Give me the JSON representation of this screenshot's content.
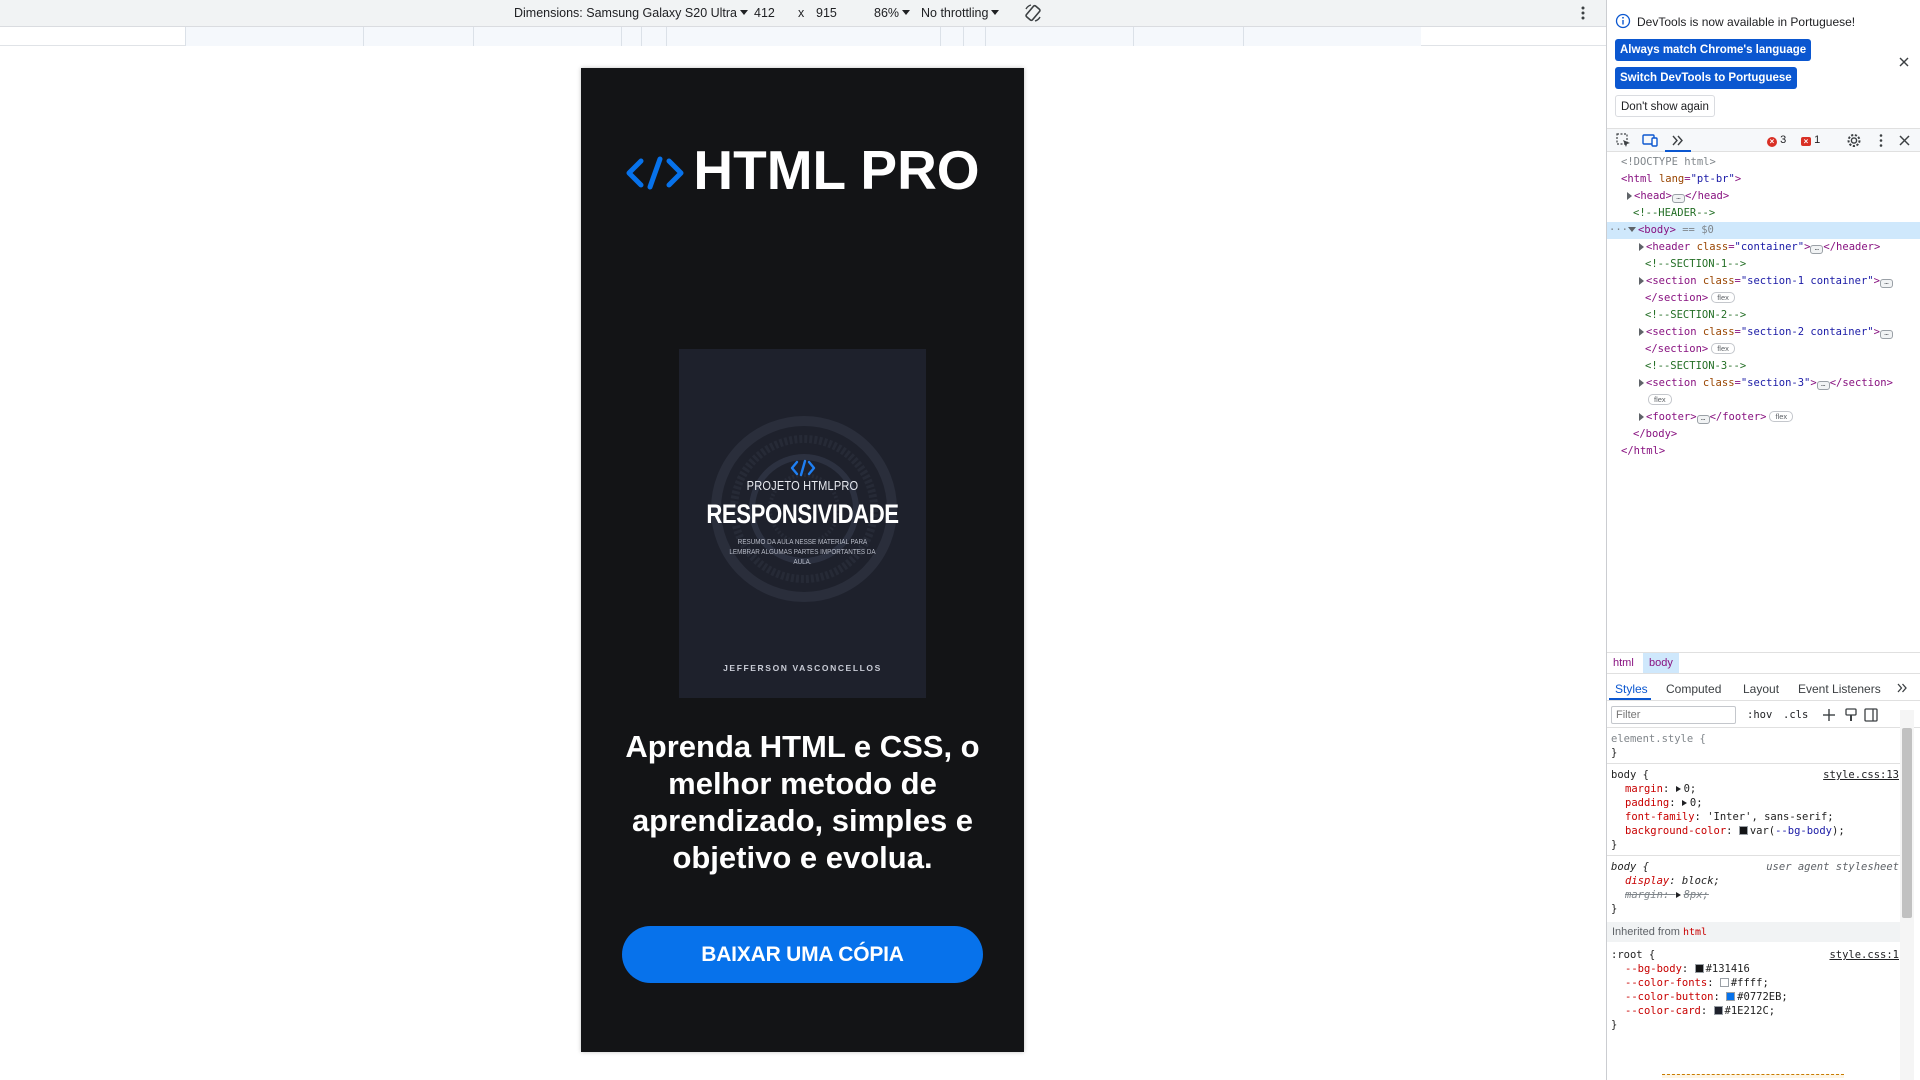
{
  "device_toolbar": {
    "dimensions_label": "Dimensions: Samsung Galaxy S20 Ultra",
    "width_value": "412",
    "times_symbol": "x",
    "height_value": "915",
    "zoom_label": "86%",
    "throttling_label": "No throttling"
  },
  "page": {
    "logo_text": "HTML PRO",
    "cover": {
      "project_label": "PROJETO HTMLPRO",
      "title": "RESPONSIVIDADE",
      "description": "RESUMO DA AULA NESSE MATERIAL PARA LEMBRAR ALGUMAS PARTES IMPORTANTES DA AULA.",
      "author": "JEFFERSON VASCONCELLOS"
    },
    "headline": "Aprenda HTML e CSS, o melhor metodo de aprendizado, simples e objetivo e evolua.",
    "download_button": "BAIXAR UMA CÓPIA"
  },
  "devtools": {
    "notice": {
      "text": "DevTools is now available in Portuguese!",
      "match_button": "Always match Chrome's language",
      "switch_button": "Switch DevTools to Portuguese",
      "dont_show_button": "Don't show again"
    },
    "error_count": "3",
    "warning_count": "1",
    "elements": {
      "doctype": "<!DOCTYPE html>",
      "html_open_tag": "<html",
      "lang_attr": "lang",
      "lang_val": "\"pt-br\"",
      "head_open": "<head>",
      "head_close": "</head>",
      "comment_header": "<!--HEADER-->",
      "body_open": "<body>",
      "body_eq": "== $0",
      "header_open": "<header",
      "class_attr": "class",
      "header_class": "\"container\"",
      "header_close": "</header>",
      "comment_s1": "<!--SECTION-1-->",
      "section_open": "<section",
      "s1_class": "\"section-1 container\"",
      "section_close": "</section>",
      "comment_s2": "<!--SECTION-2-->",
      "s2_class": "\"section-2 container\"",
      "comment_s3": "<!--SECTION-3-->",
      "s3_class": "\"section-3\"",
      "footer_open": "<footer>",
      "footer_close": "</footer>",
      "body_close": "</body>",
      "html_close": "</html>",
      "flex_badge": "flex"
    },
    "breadcrumb": [
      "html",
      "body"
    ],
    "styles_tabs": [
      "Styles",
      "Computed",
      "Layout",
      "Event Listeners"
    ],
    "filter_placeholder": "Filter",
    "hov_label": ":hov",
    "cls_label": ".cls",
    "styles": {
      "element_style": "element.style {",
      "close_brace": "}",
      "body_selector": "body {",
      "body_source": "style.css:13",
      "margin_prop": "margin",
      "margin_val": "0;",
      "padding_prop": "padding",
      "padding_val": "0;",
      "font_family_prop": "font-family",
      "font_family_val": "'Inter', sans-serif;",
      "bg_color_prop": "background-color",
      "bg_color_var_fn": "var(",
      "bg_color_var_name": "--bg-body",
      "bg_color_var_end": ");",
      "ua_selector": "body {",
      "ua_source": "user agent stylesheet",
      "display_prop": "display",
      "display_val": "block;",
      "ua_margin_prop": "margin",
      "ua_margin_val": "8px;",
      "inherited_from": "Inherited from",
      "inherited_tag": "html",
      "root_selector": ":root {",
      "root_source": "style.css:1",
      "vars": [
        {
          "name": "--bg-body",
          "value": "#131416",
          "color": "#131416"
        },
        {
          "name": "--color-fonts",
          "value": "#ffff;",
          "color": "#ffffff"
        },
        {
          "name": "--color-button",
          "value": "#0772EB;",
          "color": "#0772EB"
        },
        {
          "name": "--color-card",
          "value": "#1E212C;",
          "color": "#1E212C"
        }
      ]
    }
  },
  "colors": {
    "page_bg": "#131416",
    "button": "#0772EB",
    "card": "#1E212C",
    "devtools_accent": "#0b57d0"
  }
}
